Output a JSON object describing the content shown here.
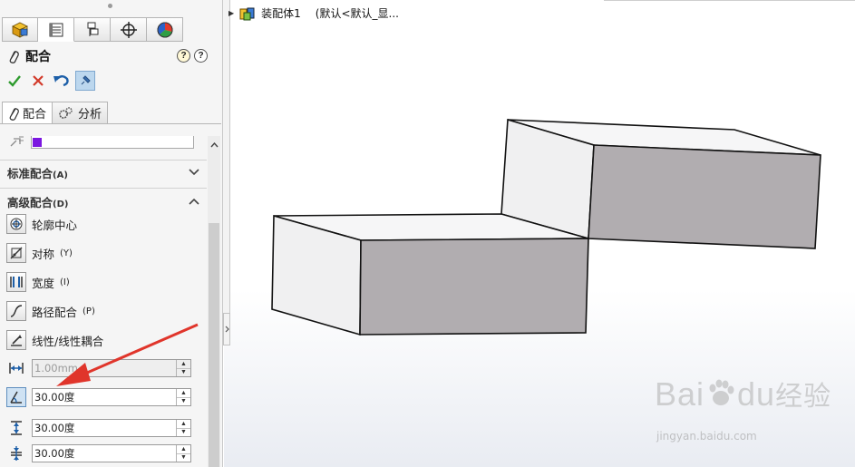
{
  "manager_tabs": [
    {
      "icon": "feature-manager-icon"
    },
    {
      "icon": "property-manager-icon",
      "active": true
    },
    {
      "icon": "configuration-manager-icon"
    },
    {
      "icon": "dimxpert-manager-icon"
    },
    {
      "icon": "display-manager-icon"
    }
  ],
  "header": {
    "title": "配合",
    "help_glyph": "?",
    "help2_glyph": "?"
  },
  "subtabs": {
    "mates": "配合",
    "analysis": "分析"
  },
  "groups": {
    "standard": {
      "label": "标准配合",
      "hotkey": "(A)"
    },
    "advanced": {
      "label": "高级配合",
      "hotkey": "(D)"
    }
  },
  "advanced_mates": [
    {
      "label": "轮廓中心",
      "hotkey": ""
    },
    {
      "label": "对称",
      "hotkey": "(Y)"
    },
    {
      "label": "宽度",
      "hotkey": "(I)"
    },
    {
      "label": "路径配合",
      "hotkey": "(P)"
    },
    {
      "label": "线性/线性耦合",
      "hotkey": ""
    }
  ],
  "fields": {
    "distance": "1.00mm",
    "angle": "30.00度",
    "max": "30.00度",
    "min": "30.00度"
  },
  "tree": {
    "name": "装配体1",
    "config": "(默认<默认_显..."
  },
  "watermark": {
    "brand": "Bai",
    "brand2": "du",
    "suffix": "经验",
    "url": "jingyan.baidu.com"
  },
  "colors": {
    "accent": "#7b17e0",
    "face_dark": "#b1adb0",
    "face_light": "#f3f3f4"
  }
}
